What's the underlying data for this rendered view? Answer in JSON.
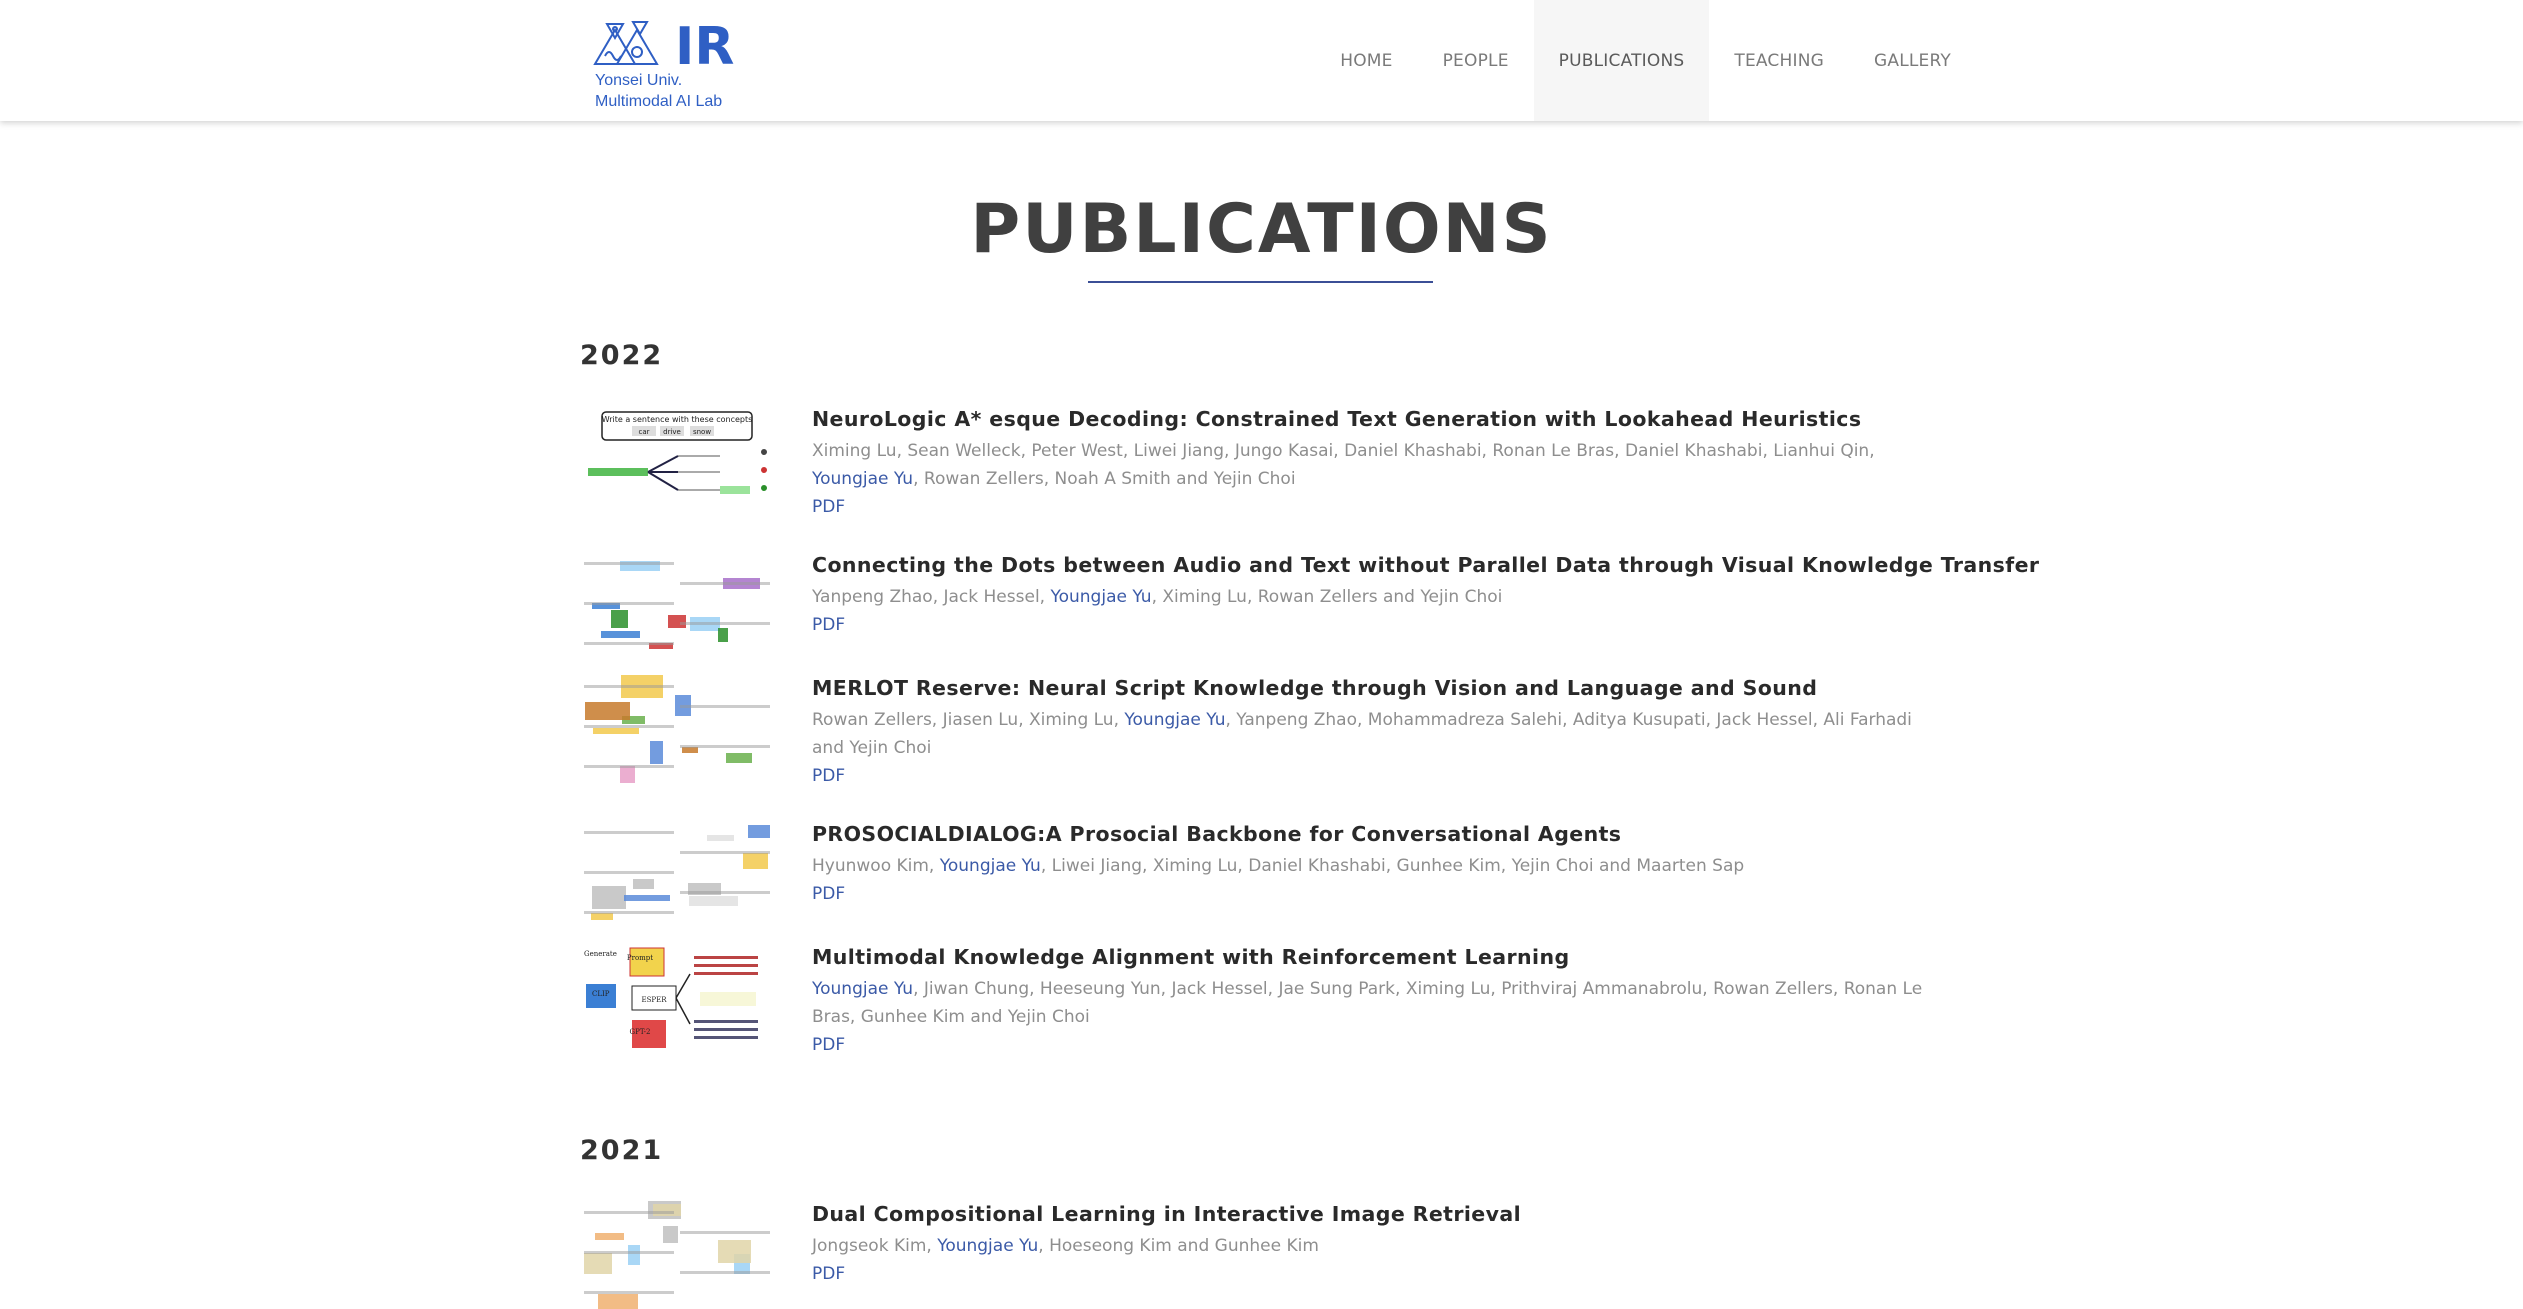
{
  "header": {
    "logo_letters": "IR",
    "logo_line1": "Yonsei Univ.",
    "logo_line2": "Multimodal AI Lab",
    "brand_color": "#2f5fc4",
    "nav": [
      {
        "label": "HOME",
        "active": false
      },
      {
        "label": "PEOPLE",
        "active": false
      },
      {
        "label": "PUBLICATIONS",
        "active": true
      },
      {
        "label": "TEACHING",
        "active": false
      },
      {
        "label": "GALLERY",
        "active": false
      }
    ]
  },
  "page_title": "PUBLICATIONS",
  "accent_color": "#3b5aa7",
  "sections": [
    {
      "year": "2022",
      "pubs": [
        {
          "title": "NeuroLogic A* esque Decoding: Constrained Text Generation with Lookahead Heuristics",
          "authors": [
            {
              "text": "Ximing Lu, Sean Welleck, Peter West, Liwei Jiang, Jungo Kasai, Daniel Khashabi, Ronan Le Bras, Daniel Khashabi, Lianhui Qin, ",
              "hl": false
            },
            {
              "text": "Youngjae Yu",
              "hl": true
            },
            {
              "text": ", Rowan Zellers, Noah A Smith and Yejin Choi",
              "hl": false
            }
          ],
          "pdf": "PDF",
          "thumb_text": [
            "Write a sentence with these concepts",
            "car",
            "drive",
            "snow"
          ]
        },
        {
          "title": "Connecting the Dots between Audio and Text without Parallel Data through Visual Knowledge Transfer",
          "authors": [
            {
              "text": "Yanpeng Zhao, Jack Hessel, ",
              "hl": false
            },
            {
              "text": "Youngjae Yu",
              "hl": true
            },
            {
              "text": ", Ximing Lu, Rowan Zellers and Yejin Choi",
              "hl": false
            }
          ],
          "pdf": "PDF"
        },
        {
          "title": "MERLOT Reserve: Neural Script Knowledge through Vision and Language and Sound",
          "authors": [
            {
              "text": "Rowan Zellers, Jiasen Lu, Ximing Lu, ",
              "hl": false
            },
            {
              "text": "Youngjae Yu",
              "hl": true
            },
            {
              "text": ", Yanpeng Zhao, Mohammadreza Salehi, Aditya Kusupati, Jack Hessel, Ali Farhadi and Yejin Choi",
              "hl": false
            }
          ],
          "pdf": "PDF"
        },
        {
          "title": "PROSOCIALDIALOG:A Prosocial Backbone for Conversational Agents",
          "authors": [
            {
              "text": "Hyunwoo Kim, ",
              "hl": false
            },
            {
              "text": "Youngjae Yu",
              "hl": true
            },
            {
              "text": ", Liwei Jiang, Ximing Lu, Daniel Khashabi, Gunhee Kim, Yejin Choi and Maarten Sap",
              "hl": false
            }
          ],
          "pdf": "PDF"
        },
        {
          "title": "Multimodal Knowledge Alignment with Reinforcement Learning",
          "authors": [
            {
              "text": "Youngjae Yu",
              "hl": true
            },
            {
              "text": ", Jiwan Chung, Heeseung Yun, Jack Hessel, Jae Sung Park, Ximing Lu, Prithviraj Ammanabrolu, Rowan Zellers, Ronan Le Bras, Gunhee Kim and Yejin Choi",
              "hl": false
            }
          ],
          "pdf": "PDF",
          "thumb_text": [
            "Generate",
            "Prompt",
            "ESPER",
            "CLIP",
            "GPT-2"
          ]
        }
      ]
    },
    {
      "year": "2021",
      "pubs": [
        {
          "title": "Dual Compositional Learning in Interactive Image Retrieval",
          "authors": [
            {
              "text": "Jongseok Kim, ",
              "hl": false
            },
            {
              "text": "Youngjae Yu",
              "hl": true
            },
            {
              "text": ", Hoeseong Kim and Gunhee Kim",
              "hl": false
            }
          ],
          "pdf": "PDF"
        }
      ]
    }
  ]
}
